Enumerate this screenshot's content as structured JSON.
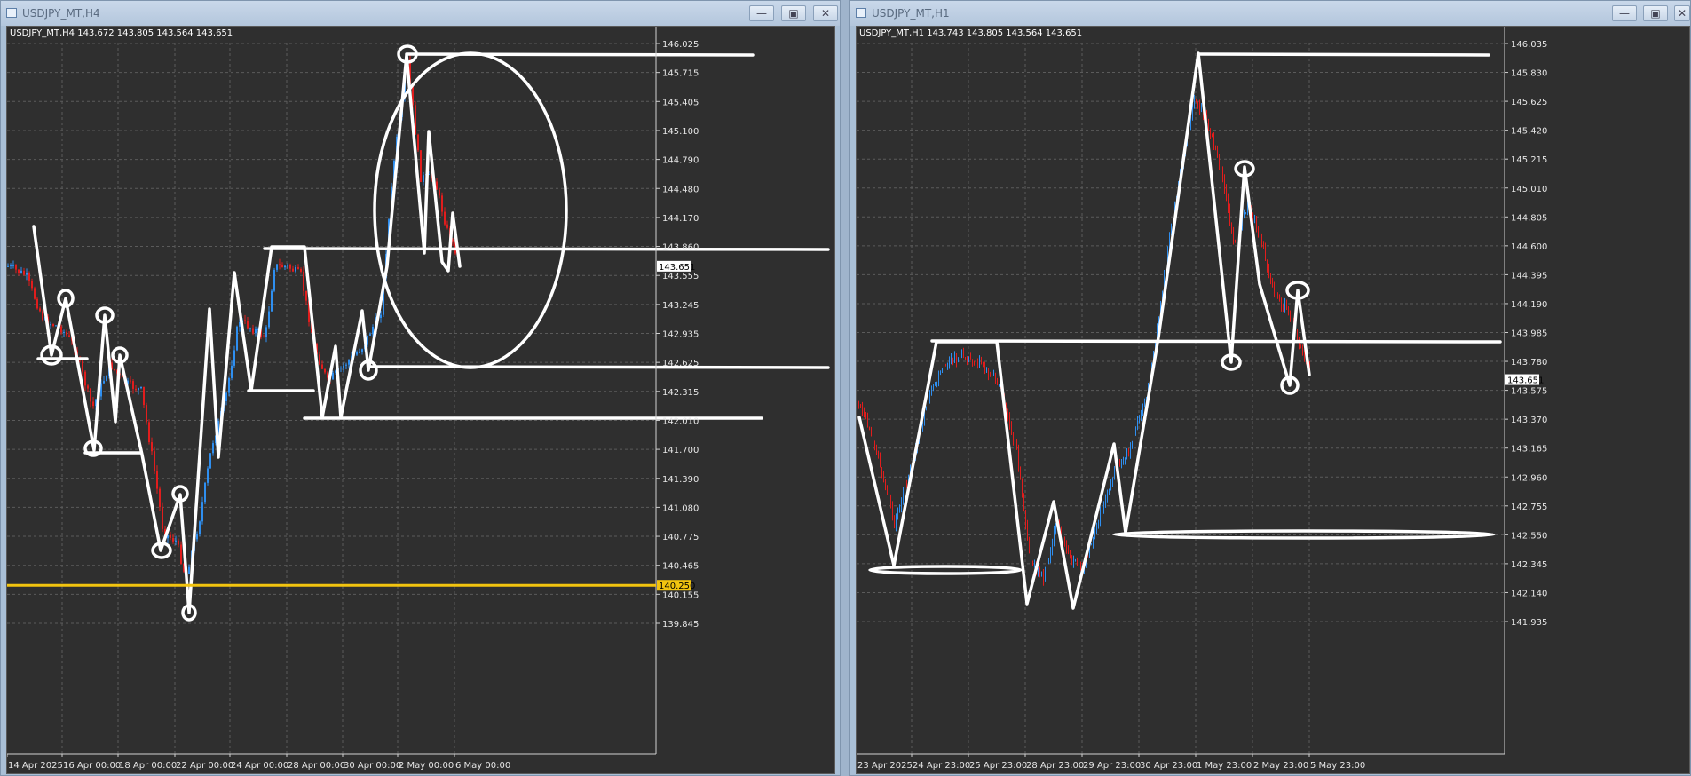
{
  "windows": [
    {
      "title": "USDJPY_MT,H4",
      "info": "USDJPY_MT,H4  143.672 143.805 143.564 143.651",
      "buttons": {
        "minimize": "—",
        "maximize": "▣",
        "close": "✕"
      },
      "price_axis": [
        "146.025",
        "145.715",
        "145.405",
        "145.100",
        "144.790",
        "144.480",
        "144.170",
        "143.860",
        "143.555",
        "143.245",
        "142.935",
        "142.625",
        "142.315",
        "142.010",
        "141.700",
        "141.390",
        "141.080",
        "140.775",
        "140.465",
        "140.155",
        "139.845"
      ],
      "time_axis": [
        "14 Apr 2025",
        "16 Apr 00:00",
        "18 Apr 00:00",
        "22 Apr 00:00",
        "24 Apr 00:00",
        "28 Apr 00:00",
        "30 Apr 00:00",
        "2 May 00:00",
        "6 May 00:00"
      ],
      "current_price": "143.651",
      "level_label": "140.250",
      "colors": {
        "bull": "#2f8ff0",
        "bear": "#e11d1d",
        "level": "#f2c40f",
        "drawing": "#ffffff"
      }
    },
    {
      "title": "USDJPY_MT,H1",
      "info": "USDJPY_MT,H1  143.743 143.805 143.564 143.651",
      "buttons": {
        "minimize": "—",
        "maximize": "▣",
        "close": "✕"
      },
      "price_axis": [
        "146.035",
        "145.830",
        "145.625",
        "145.420",
        "145.215",
        "145.010",
        "144.805",
        "144.600",
        "144.395",
        "144.190",
        "143.985",
        "143.780",
        "143.575",
        "143.370",
        "143.165",
        "142.960",
        "142.755",
        "142.550",
        "142.345",
        "142.140",
        "141.935"
      ],
      "time_axis": [
        "23 Apr 2025",
        "24 Apr 23:00",
        "25 Apr 23:00",
        "28 Apr 23:00",
        "29 Apr 23:00",
        "30 Apr 23:00",
        "1 May 23:00",
        "2 May 23:00",
        "5 May 23:00"
      ],
      "current_price": "143.651",
      "colors": {
        "bull": "#2f8ff0",
        "bear": "#e11d1d",
        "drawing": "#ffffff"
      }
    }
  ]
}
